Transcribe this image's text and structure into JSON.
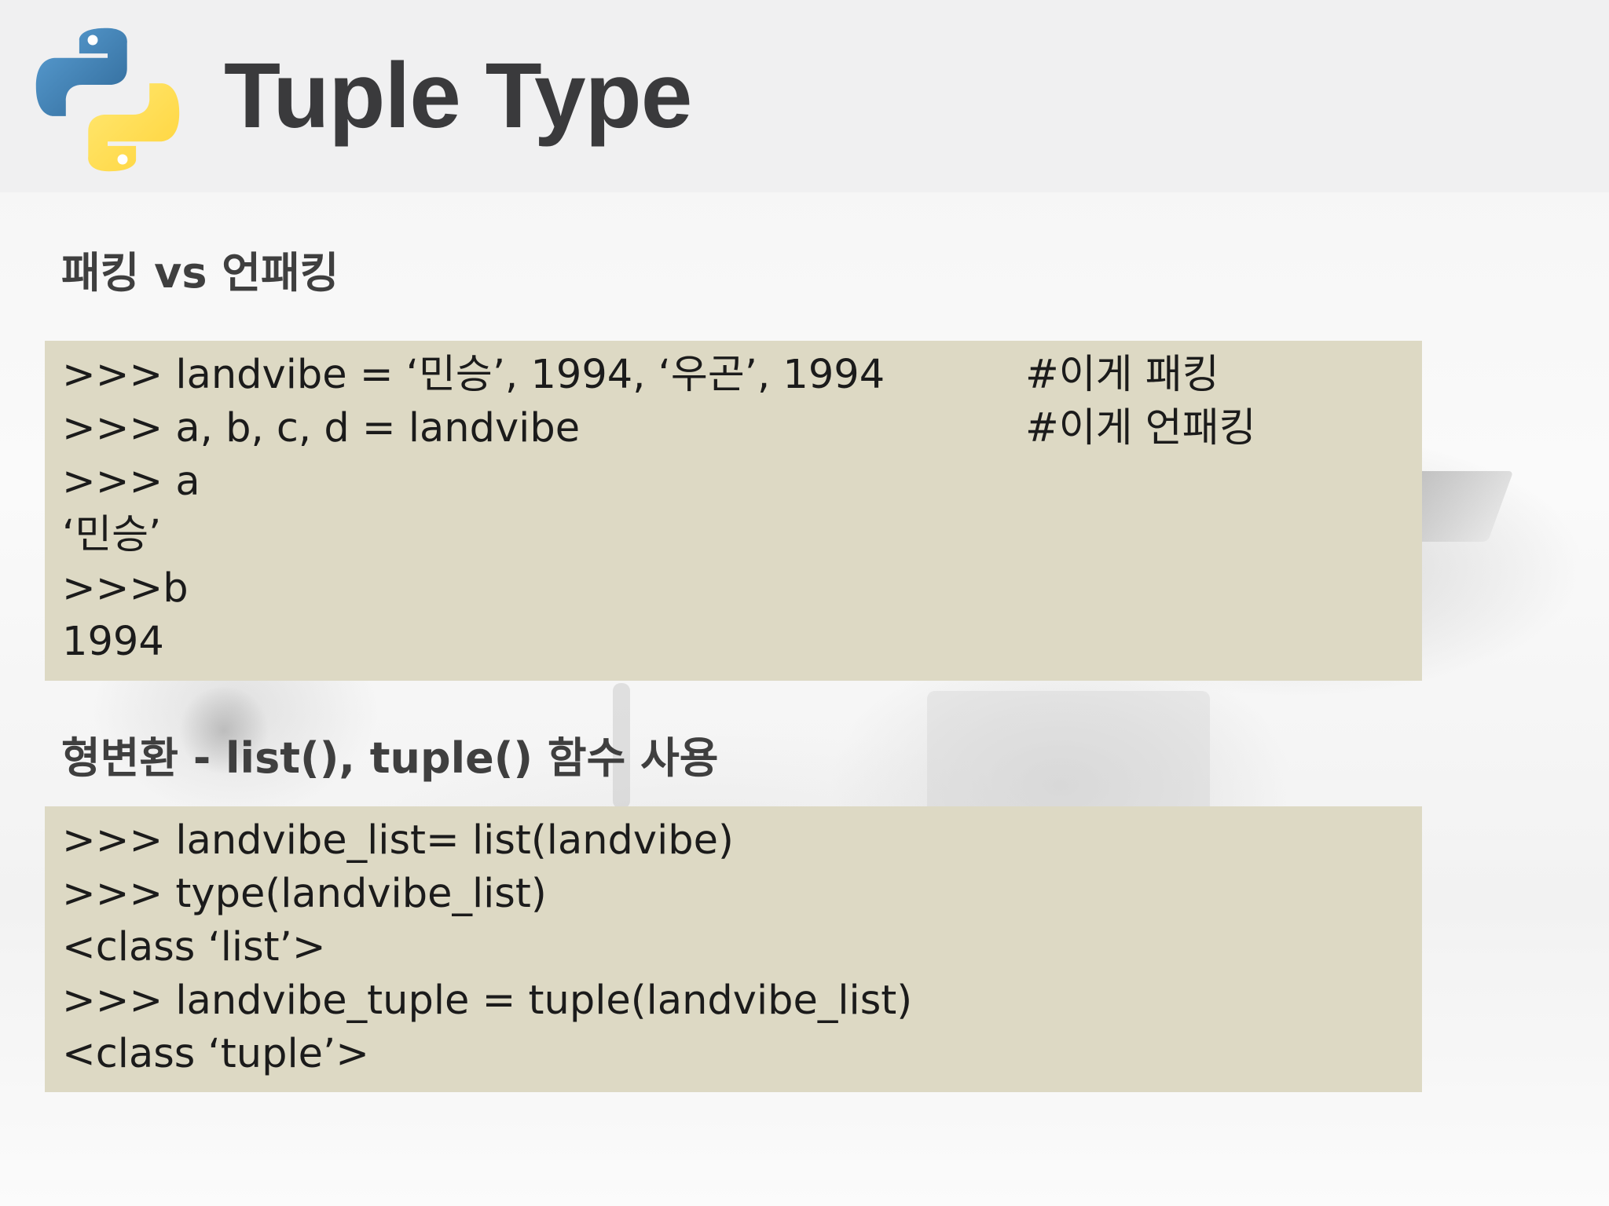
{
  "slide": {
    "title": "Tuple Type",
    "logo_icon": "python-logo-icon"
  },
  "sections": [
    {
      "heading": "패킹 vs 언패킹",
      "code_lines": [
        {
          "code": ">>> landvibe = ‘민승’, 1994, ‘우곤’, 1994",
          "comment": "#이게 패킹"
        },
        {
          "code": ">>> a, b, c, d = landvibe",
          "comment": "#이게 언패킹"
        },
        {
          "code": ">>> a",
          "comment": ""
        },
        {
          "code": "‘민승’",
          "comment": ""
        },
        {
          "code": ">>>b",
          "comment": ""
        },
        {
          "code": "1994",
          "comment": ""
        }
      ]
    },
    {
      "heading": "형변환 - list(), tuple() 함수 사용",
      "code_lines": [
        {
          "code": ">>> landvibe_list= list(landvibe)",
          "comment": ""
        },
        {
          "code": ">>> type(landvibe_list)",
          "comment": ""
        },
        {
          "code": "<class ‘list’>",
          "comment": ""
        },
        {
          "code": ">>> landvibe_tuple = tuple(landvibe_list)",
          "comment": ""
        },
        {
          "code": "<class ‘tuple’>",
          "comment": ""
        }
      ]
    }
  ],
  "colors": {
    "code_background": "#ddd9c4",
    "title_text": "#3a3a3c",
    "python_blue": "#3a74a8",
    "python_yellow": "#f5cf3a"
  }
}
